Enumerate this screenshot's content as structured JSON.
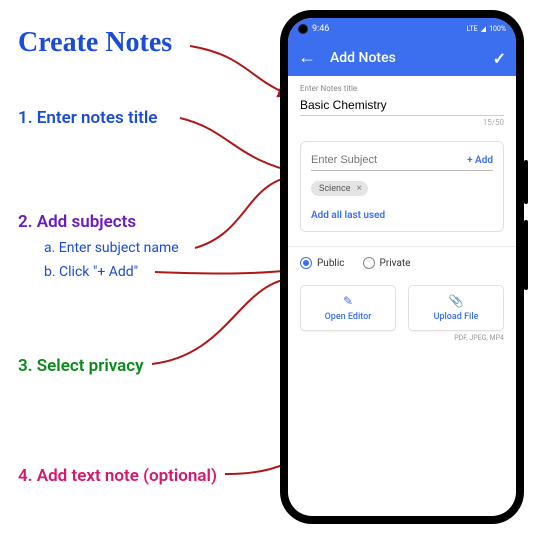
{
  "annotations": {
    "title": "Create Notes",
    "step1": "1. Enter notes title",
    "step2": "2. Add subjects",
    "step2a": "a. Enter subject name",
    "step2b": "b. Click \"+ Add\"",
    "step3": "3. Select privacy",
    "step4": "4. Add text note (optional)"
  },
  "statusbar": {
    "time": "9:46",
    "network": "LTE",
    "battery": "100%"
  },
  "header": {
    "title": "Add Notes"
  },
  "title_field": {
    "label": "Enter Notes title",
    "value": "Basic Chemistry",
    "counter": "15/50"
  },
  "subject": {
    "placeholder": "Enter Subject",
    "add_button": "+ Add",
    "chip": "Science",
    "add_last": "Add all last used"
  },
  "privacy": {
    "public": "Public",
    "private": "Private"
  },
  "actions": {
    "open_editor": "Open Editor",
    "upload_file": "Upload File",
    "file_types": "PDF, JPEG, MP4"
  },
  "icons": {
    "back": "←",
    "check": "✓",
    "close": "×",
    "edit": "✎",
    "attach": "📎",
    "camera": "●",
    "signal": "▮▮"
  }
}
